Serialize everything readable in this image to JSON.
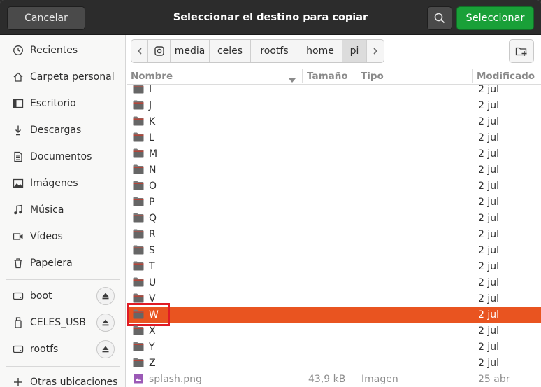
{
  "window": {
    "title": "Seleccionar el destino para copiar",
    "cancel_label": "Cancelar",
    "select_label": "Seleccionar"
  },
  "sidebar": {
    "places": [
      {
        "label": "Recientes",
        "icon": "clock-icon"
      },
      {
        "label": "Carpeta personal",
        "icon": "home-icon"
      },
      {
        "label": "Escritorio",
        "icon": "desktop-icon"
      },
      {
        "label": "Descargas",
        "icon": "download-icon"
      },
      {
        "label": "Documentos",
        "icon": "document-icon"
      },
      {
        "label": "Imágenes",
        "icon": "image-icon"
      },
      {
        "label": "Música",
        "icon": "music-icon"
      },
      {
        "label": "Vídeos",
        "icon": "video-icon"
      },
      {
        "label": "Papelera",
        "icon": "trash-icon"
      }
    ],
    "devices": [
      {
        "label": "boot",
        "icon": "drive-icon"
      },
      {
        "label": "CELES_USB",
        "icon": "usb-icon"
      },
      {
        "label": "rootfs",
        "icon": "drive-icon"
      }
    ],
    "other_locations": "Otras ubicaciones"
  },
  "pathbar": {
    "segments": [
      "media",
      "celes",
      "rootfs",
      "home",
      "pi"
    ],
    "active": "pi"
  },
  "columns": {
    "name": "Nombre",
    "size": "Tamaño",
    "type": "Tipo",
    "modified": "Modificado"
  },
  "files": [
    {
      "name": "I",
      "size": "",
      "type": "",
      "modified": "2 jul"
    },
    {
      "name": "J",
      "size": "",
      "type": "",
      "modified": "2 jul"
    },
    {
      "name": "K",
      "size": "",
      "type": "",
      "modified": "2 jul"
    },
    {
      "name": "L",
      "size": "",
      "type": "",
      "modified": "2 jul"
    },
    {
      "name": "M",
      "size": "",
      "type": "",
      "modified": "2 jul"
    },
    {
      "name": "N",
      "size": "",
      "type": "",
      "modified": "2 jul"
    },
    {
      "name": "O",
      "size": "",
      "type": "",
      "modified": "2 jul"
    },
    {
      "name": "P",
      "size": "",
      "type": "",
      "modified": "2 jul"
    },
    {
      "name": "Q",
      "size": "",
      "type": "",
      "modified": "2 jul"
    },
    {
      "name": "R",
      "size": "",
      "type": "",
      "modified": "2 jul"
    },
    {
      "name": "S",
      "size": "",
      "type": "",
      "modified": "2 jul"
    },
    {
      "name": "T",
      "size": "",
      "type": "",
      "modified": "2 jul"
    },
    {
      "name": "U",
      "size": "",
      "type": "",
      "modified": "2 jul"
    },
    {
      "name": "V",
      "size": "",
      "type": "",
      "modified": "2 jul"
    },
    {
      "name": "W",
      "size": "",
      "type": "",
      "modified": "2 jul",
      "selected": true
    },
    {
      "name": "X",
      "size": "",
      "type": "",
      "modified": "2 jul"
    },
    {
      "name": "Y",
      "size": "",
      "type": "",
      "modified": "2 jul"
    },
    {
      "name": "Z",
      "size": "",
      "type": "",
      "modified": "2 jul"
    },
    {
      "name": "splash.png",
      "size": "43,9 kB",
      "type": "Imagen",
      "modified": "25 abr",
      "is_image": true
    }
  ],
  "colors": {
    "accent": "#e95420",
    "select_button": "#19a038",
    "headerbar": "#2c2c2c",
    "annotation_box": "#e01b24"
  }
}
